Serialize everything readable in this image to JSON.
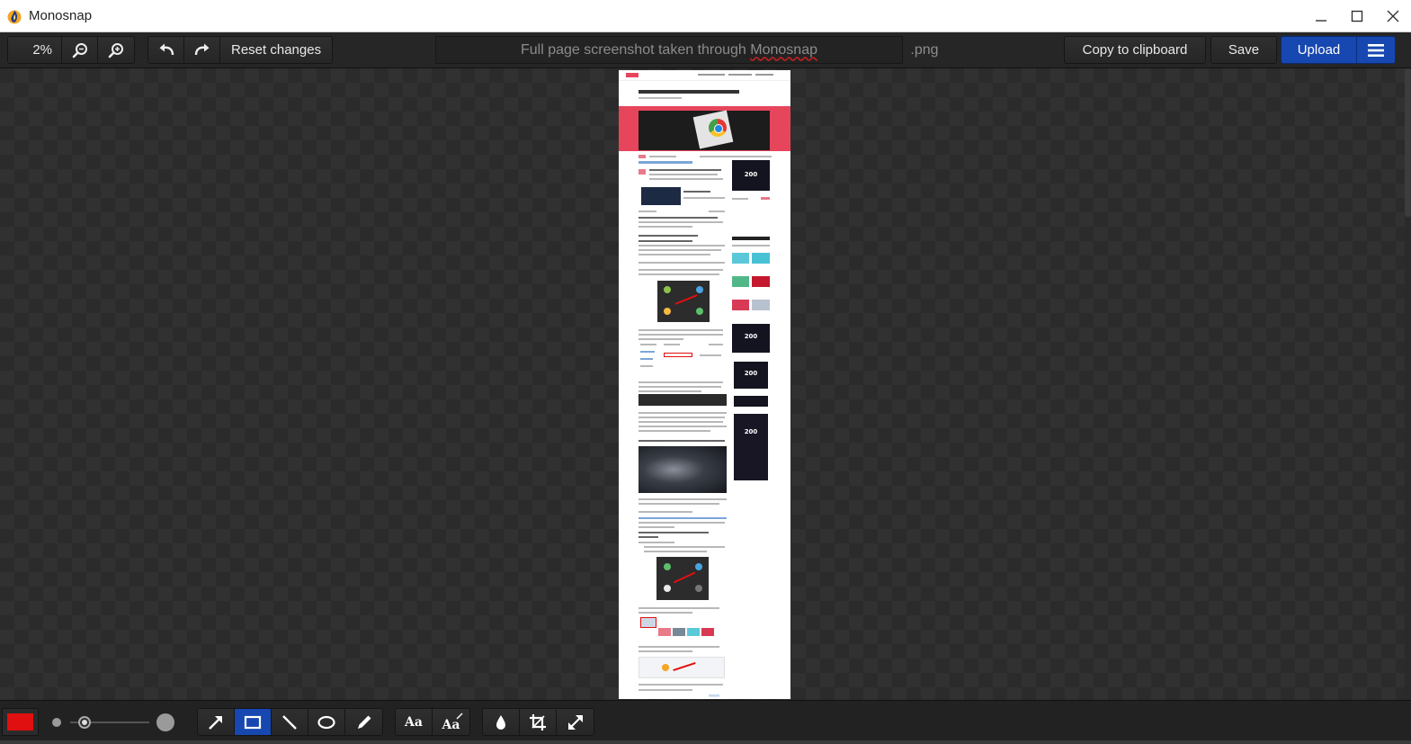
{
  "window": {
    "title": "Monosnap",
    "icon": "monosnap-flame-icon",
    "controls": [
      "minimize-icon",
      "maximize-icon",
      "close-icon"
    ]
  },
  "toolbar": {
    "zoom": "2%",
    "zoom_out_icon": "zoom-out-icon",
    "zoom_in_icon": "zoom-in-icon",
    "undo_icon": "undo-icon",
    "redo_icon": "redo-icon",
    "reset_label": "Reset changes",
    "filename_prefix": "Full page screenshot taken through ",
    "filename_brand": "Monosnap",
    "extension": ".png",
    "copy_label": "Copy to clipboard",
    "save_label": "Save",
    "upload_label": "Upload",
    "menu_icon": "hamburger-menu-icon"
  },
  "preview": {
    "ad_badge_1": "200",
    "ad_badge_2": "200",
    "ad_badge_3": "200",
    "ad_badge_4": "200"
  },
  "bottom_toolbar": {
    "color": "#e01010",
    "tools": [
      {
        "name": "arrow-tool",
        "icon": "arrow-icon",
        "active": false
      },
      {
        "name": "rectangle-tool",
        "icon": "rectangle-icon",
        "active": true
      },
      {
        "name": "line-tool",
        "icon": "line-icon",
        "active": false
      },
      {
        "name": "ellipse-tool",
        "icon": "ellipse-icon",
        "active": false
      },
      {
        "name": "pen-tool",
        "icon": "pencil-icon",
        "active": false
      }
    ],
    "text_tool_label": "Aa",
    "text_callout_label": "Aa",
    "extra_tools": [
      "blur-drop-icon",
      "crop-icon",
      "resize-icon"
    ]
  },
  "colors": {
    "accent": "#1747b0",
    "brand_pink": "#e6455c",
    "annotation_red": "#e01010"
  }
}
